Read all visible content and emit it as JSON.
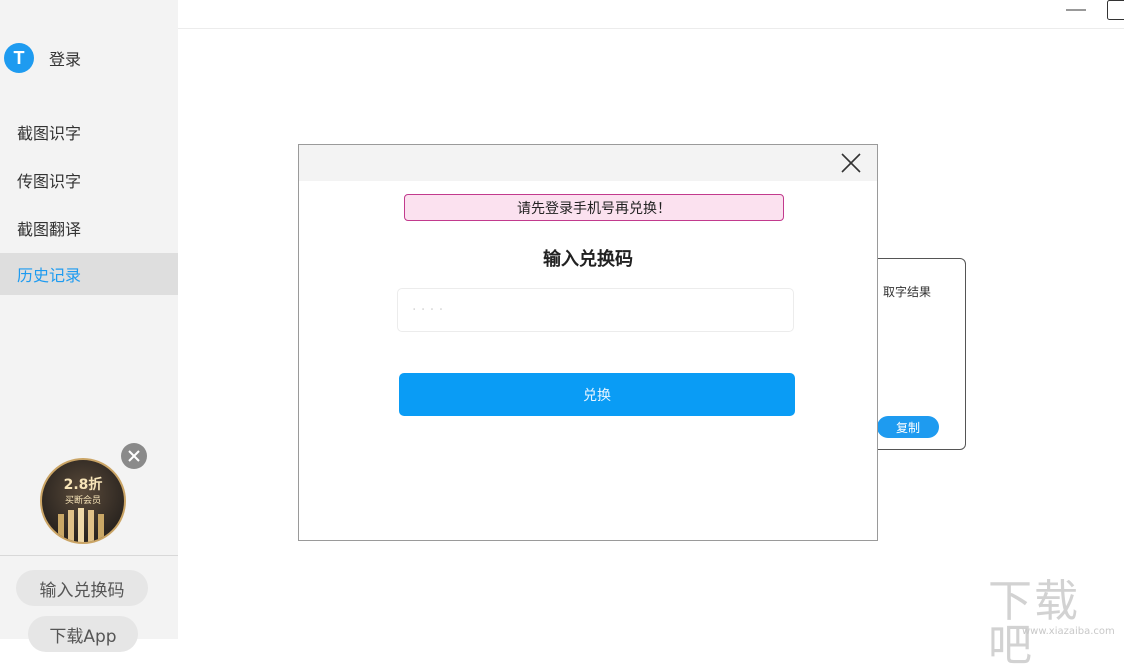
{
  "sidebar": {
    "login": {
      "avatar_letter": "T",
      "label": "登录"
    },
    "items": [
      {
        "label": "截图识字"
      },
      {
        "label": "传图识字"
      },
      {
        "label": "截图翻译"
      },
      {
        "label": "历史记录",
        "active": true
      }
    ],
    "promo": {
      "price": "2.8折",
      "subtitle": "买断会员"
    },
    "bottom_buttons": {
      "redeem": "输入兑换码",
      "download": "下载App"
    }
  },
  "result_card": {
    "title": "取字结果",
    "copy_label": "复制"
  },
  "modal": {
    "alert": "请先登录手机号再兑换！",
    "title": "输入兑换码",
    "input_placeholder": "· · · ·",
    "input_value": "",
    "submit_label": "兑换"
  },
  "watermark": {
    "text": "下载吧",
    "url": "www.xiazaiba.com"
  },
  "colors": {
    "accent": "#1e9bf0",
    "alert_bg": "#fbe1ef",
    "alert_border": "#c23a8d"
  }
}
